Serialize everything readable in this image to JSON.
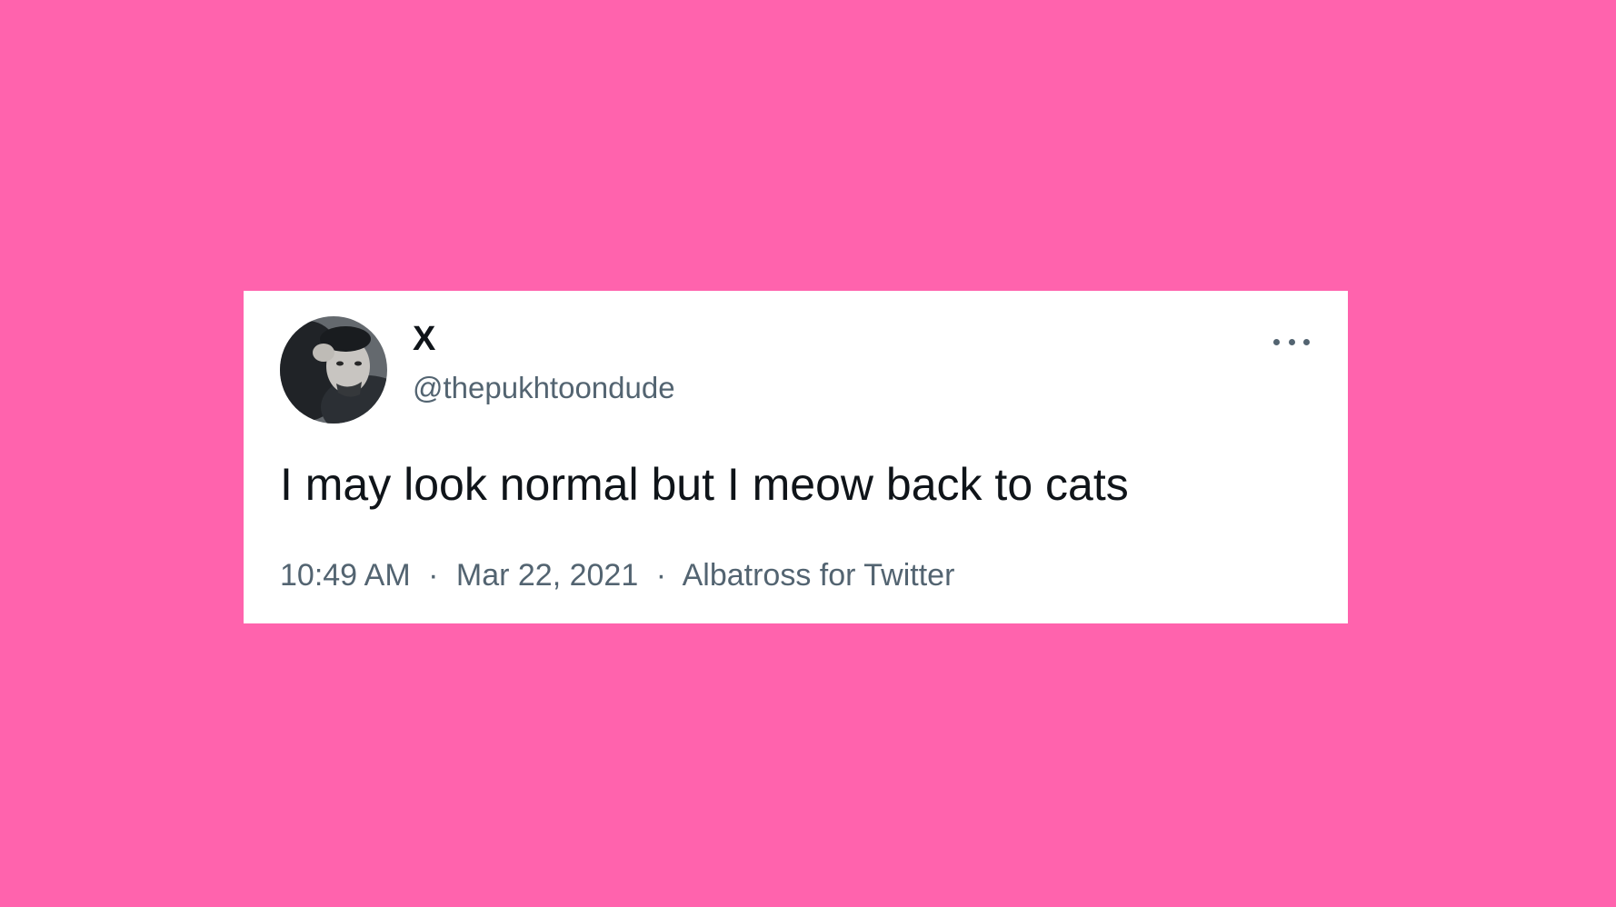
{
  "colors": {
    "background": "#ff63ad",
    "card": "#ffffff",
    "text_primary": "#0f1419",
    "text_secondary": "#536471"
  },
  "tweet": {
    "author": {
      "display_name": "X",
      "handle": "@thepukhtoondude",
      "avatar_icon": "profile-photo"
    },
    "more_icon": "more-horizontal-icon",
    "text": "I may look normal but I meow back to cats",
    "time": "10:49 AM",
    "separator": "·",
    "date": "Mar 22, 2021",
    "source": "Albatross for Twitter"
  }
}
